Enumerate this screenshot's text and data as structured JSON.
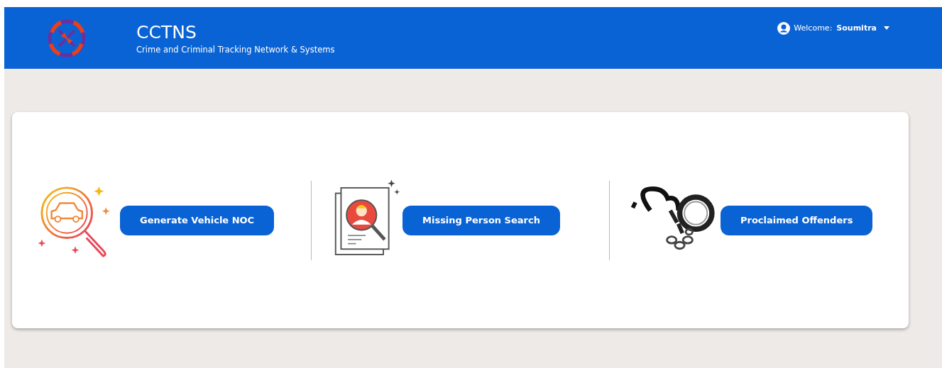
{
  "header": {
    "title": "CCTNS",
    "subtitle": "Crime and Criminal Tracking Network & Systems",
    "user": {
      "greeting": "Welcome:",
      "name": "Soumitra"
    }
  },
  "actions": [
    {
      "kind": "vehicle",
      "label": "Generate Vehicle NOC"
    },
    {
      "kind": "person",
      "label": "Missing Person Search"
    },
    {
      "kind": "handcuffs",
      "label": "Proclaimed Offenders"
    }
  ]
}
